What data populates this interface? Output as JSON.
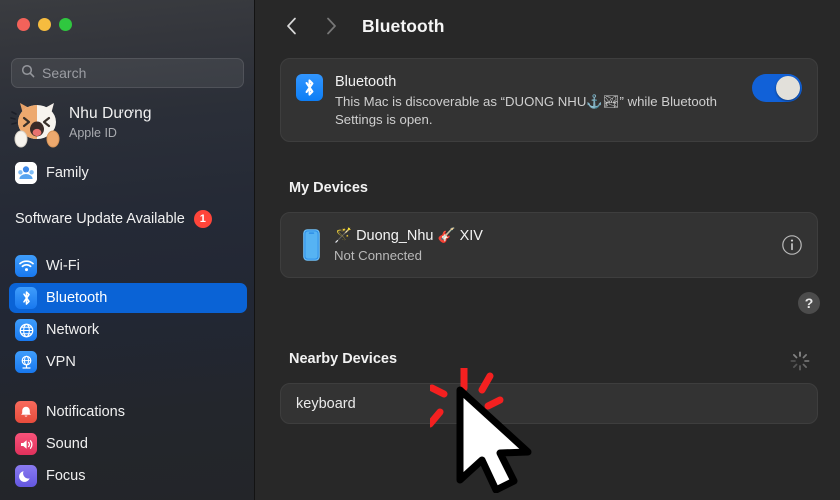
{
  "window": {
    "traffic_lights": [
      {
        "name": "close",
        "color": "#f3625a"
      },
      {
        "name": "minimize",
        "color": "#f6bc3f"
      },
      {
        "name": "maximize",
        "color": "#2fc73f"
      }
    ]
  },
  "sidebar": {
    "search": {
      "placeholder": "Search",
      "value": "",
      "icon": "search-icon"
    },
    "account": {
      "name": "Nhu Dương",
      "subtitle": "Apple ID",
      "avatar": "cat-avatar"
    },
    "family": {
      "label": "Family",
      "icon": "family-icon"
    },
    "software_update": {
      "label": "Software Update Available",
      "badge": "1",
      "badge_color": "#ff453a"
    },
    "items": [
      {
        "label": "Wi-Fi",
        "icon": "wifi-icon",
        "selected": false
      },
      {
        "label": "Bluetooth",
        "icon": "bluetooth-icon",
        "selected": true
      },
      {
        "label": "Network",
        "icon": "network-icon",
        "selected": false
      },
      {
        "label": "VPN",
        "icon": "vpn-icon",
        "selected": false
      },
      {
        "label": "Notifications",
        "icon": "notifications-icon",
        "selected": false
      },
      {
        "label": "Sound",
        "icon": "sound-icon",
        "selected": false
      },
      {
        "label": "Focus",
        "icon": "focus-icon",
        "selected": false
      }
    ],
    "selected_accent": "#0a63d6"
  },
  "main": {
    "nav": {
      "back_icon": "chevron-left-icon",
      "forward_icon": "chevron-right-icon"
    },
    "title": "Bluetooth",
    "bluetooth_card": {
      "icon": "bluetooth-app-icon",
      "title": "Bluetooth",
      "description": "This Mac is discoverable as “DUONG NHU⚓🏞” while Bluetooth Settings is open.",
      "toggle_on": true,
      "toggle_color": "#1161d8"
    },
    "my_devices": {
      "heading": "My Devices",
      "devices": [
        {
          "icon": "iphone-icon",
          "name": "🪄 Duong_Nhu 🎸 XIV",
          "status": "Not Connected",
          "info_icon": "info-circle-icon"
        }
      ]
    },
    "help_button": {
      "label": "?",
      "icon": "help-icon"
    },
    "nearby_devices": {
      "heading": "Nearby Devices",
      "spinner": "loading-spinner-icon",
      "devices": [
        {
          "name": "keyboard"
        }
      ]
    },
    "cursor": {
      "icon": "mouse-pointer-click-icon",
      "click_ray_color": "#f42020"
    }
  }
}
